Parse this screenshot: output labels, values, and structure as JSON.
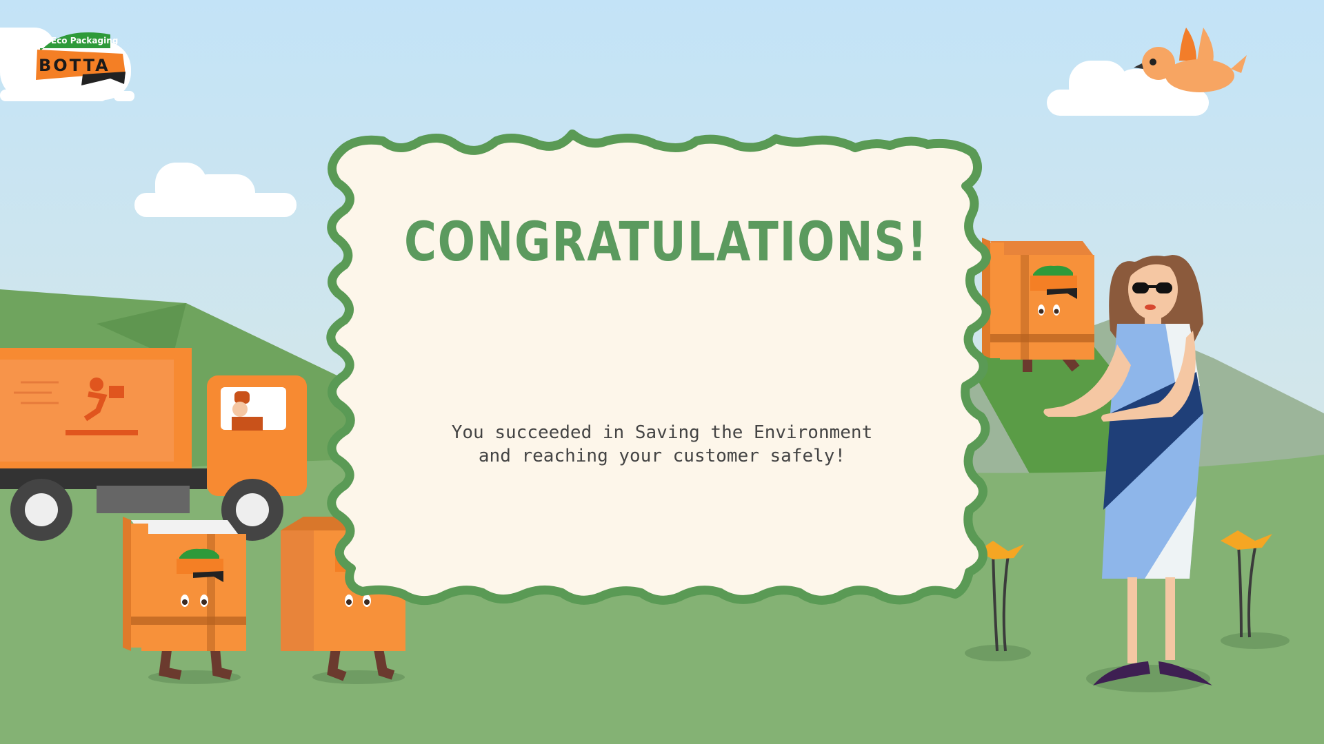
{
  "brand": {
    "tagline": "Eco Packaging",
    "name": "BOTTA"
  },
  "dialog": {
    "title": "CONGRATULATIONS!",
    "message_line1": "You succeeded in Saving the Environment",
    "message_line2": "and reaching your customer safely!"
  },
  "colors": {
    "sky_top": "#c3e3f7",
    "sky_bottom": "#d9e8dc",
    "grass": "#84b274",
    "hill_dark": "#5a9c46",
    "frame_green": "#5a9a55",
    "card_bg": "#fdf6ea",
    "title_green": "#5b9a5e",
    "box_orange": "#f7913a",
    "truck_orange": "#f78a32"
  }
}
